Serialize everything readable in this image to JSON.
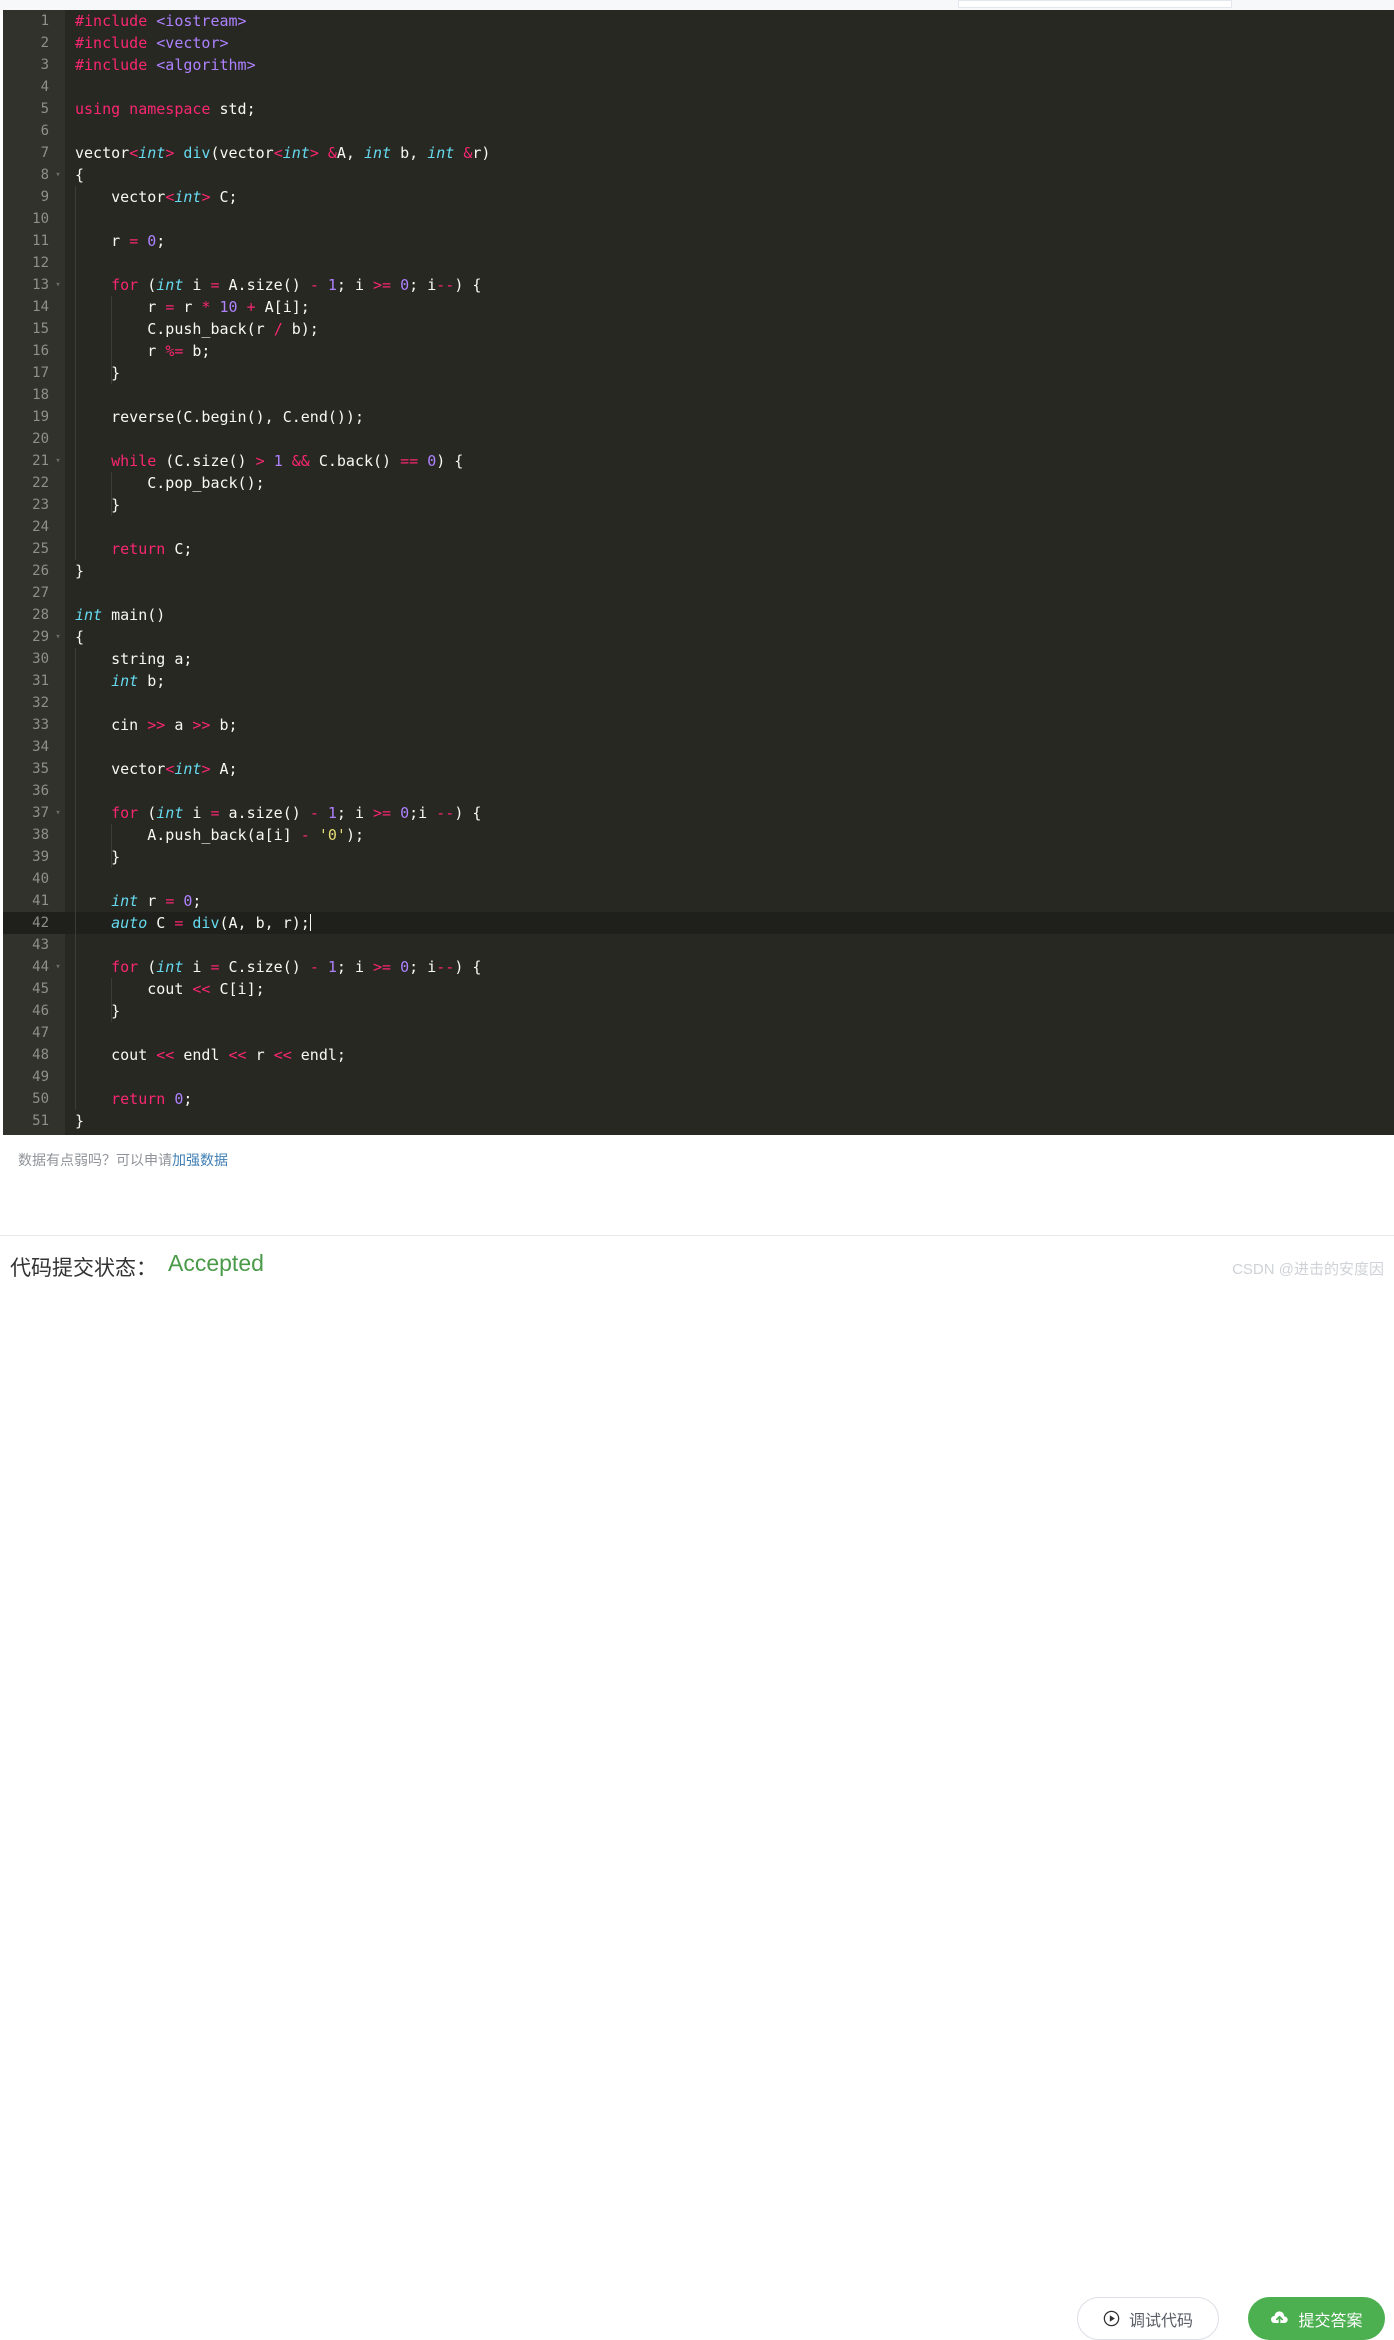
{
  "editor": {
    "language": "cpp",
    "current_line": 42,
    "theme_bg": "#272822",
    "gutter_bg": "#31322c",
    "current_line_bg": "#1f201b",
    "lines": [
      {
        "n": 1,
        "fold": false,
        "guides": 0,
        "tokens": [
          {
            "t": "#include ",
            "c": "inc"
          },
          {
            "t": "<iostream>",
            "c": "hdr"
          }
        ]
      },
      {
        "n": 2,
        "fold": false,
        "guides": 0,
        "tokens": [
          {
            "t": "#include ",
            "c": "inc"
          },
          {
            "t": "<vector>",
            "c": "hdr"
          }
        ]
      },
      {
        "n": 3,
        "fold": false,
        "guides": 0,
        "tokens": [
          {
            "t": "#include ",
            "c": "inc"
          },
          {
            "t": "<algorithm>",
            "c": "hdr"
          }
        ]
      },
      {
        "n": 4,
        "fold": false,
        "guides": 0,
        "tokens": []
      },
      {
        "n": 5,
        "fold": false,
        "guides": 0,
        "tokens": [
          {
            "t": "using namespace",
            "c": "k"
          },
          {
            "t": " std;",
            "c": "pl"
          }
        ]
      },
      {
        "n": 6,
        "fold": false,
        "guides": 0,
        "tokens": []
      },
      {
        "n": 7,
        "fold": false,
        "guides": 0,
        "tokens": [
          {
            "t": "vector",
            "c": "pl"
          },
          {
            "t": "<",
            "c": "k"
          },
          {
            "t": "int",
            "c": "ki"
          },
          {
            "t": ">",
            "c": "k"
          },
          {
            "t": " ",
            "c": "pl"
          },
          {
            "t": "div",
            "c": "fn"
          },
          {
            "t": "(vector",
            "c": "pl"
          },
          {
            "t": "<",
            "c": "k"
          },
          {
            "t": "int",
            "c": "ki"
          },
          {
            "t": ">",
            "c": "k"
          },
          {
            "t": " ",
            "c": "pl"
          },
          {
            "t": "&",
            "c": "k"
          },
          {
            "t": "A, ",
            "c": "pl"
          },
          {
            "t": "int",
            "c": "ki"
          },
          {
            "t": " b, ",
            "c": "pl"
          },
          {
            "t": "int",
            "c": "ki"
          },
          {
            "t": " ",
            "c": "pl"
          },
          {
            "t": "&",
            "c": "k"
          },
          {
            "t": "r)",
            "c": "pl"
          }
        ]
      },
      {
        "n": 8,
        "fold": true,
        "guides": 0,
        "tokens": [
          {
            "t": "{",
            "c": "pl"
          }
        ]
      },
      {
        "n": 9,
        "fold": false,
        "guides": 1,
        "tokens": [
          {
            "t": "    vector",
            "c": "pl"
          },
          {
            "t": "<",
            "c": "k"
          },
          {
            "t": "int",
            "c": "ki"
          },
          {
            "t": ">",
            "c": "k"
          },
          {
            "t": " C;",
            "c": "pl"
          }
        ]
      },
      {
        "n": 10,
        "fold": false,
        "guides": 1,
        "tokens": []
      },
      {
        "n": 11,
        "fold": false,
        "guides": 1,
        "tokens": [
          {
            "t": "    r ",
            "c": "pl"
          },
          {
            "t": "=",
            "c": "k"
          },
          {
            "t": " ",
            "c": "pl"
          },
          {
            "t": "0",
            "c": "num"
          },
          {
            "t": ";",
            "c": "pl"
          }
        ]
      },
      {
        "n": 12,
        "fold": false,
        "guides": 1,
        "tokens": []
      },
      {
        "n": 13,
        "fold": true,
        "guides": 1,
        "tokens": [
          {
            "t": "    ",
            "c": "pl"
          },
          {
            "t": "for",
            "c": "k"
          },
          {
            "t": " (",
            "c": "pl"
          },
          {
            "t": "int",
            "c": "ki"
          },
          {
            "t": " i ",
            "c": "pl"
          },
          {
            "t": "=",
            "c": "k"
          },
          {
            "t": " A.size() ",
            "c": "pl"
          },
          {
            "t": "-",
            "c": "k"
          },
          {
            "t": " ",
            "c": "pl"
          },
          {
            "t": "1",
            "c": "num"
          },
          {
            "t": "; i ",
            "c": "pl"
          },
          {
            "t": ">=",
            "c": "k"
          },
          {
            "t": " ",
            "c": "pl"
          },
          {
            "t": "0",
            "c": "num"
          },
          {
            "t": "; i",
            "c": "pl"
          },
          {
            "t": "--",
            "c": "k"
          },
          {
            "t": ") {",
            "c": "pl"
          }
        ]
      },
      {
        "n": 14,
        "fold": false,
        "guides": 2,
        "tokens": [
          {
            "t": "        r ",
            "c": "pl"
          },
          {
            "t": "=",
            "c": "k"
          },
          {
            "t": " r ",
            "c": "pl"
          },
          {
            "t": "*",
            "c": "k"
          },
          {
            "t": " ",
            "c": "pl"
          },
          {
            "t": "10",
            "c": "num"
          },
          {
            "t": " ",
            "c": "pl"
          },
          {
            "t": "+",
            "c": "k"
          },
          {
            "t": " A[i];",
            "c": "pl"
          }
        ]
      },
      {
        "n": 15,
        "fold": false,
        "guides": 2,
        "tokens": [
          {
            "t": "        C.push_back(r ",
            "c": "pl"
          },
          {
            "t": "/",
            "c": "k"
          },
          {
            "t": " b);",
            "c": "pl"
          }
        ]
      },
      {
        "n": 16,
        "fold": false,
        "guides": 2,
        "tokens": [
          {
            "t": "        r ",
            "c": "pl"
          },
          {
            "t": "%=",
            "c": "k"
          },
          {
            "t": " b;",
            "c": "pl"
          }
        ]
      },
      {
        "n": 17,
        "fold": false,
        "guides": 2,
        "tokens": [
          {
            "t": "    }",
            "c": "pl"
          }
        ]
      },
      {
        "n": 18,
        "fold": false,
        "guides": 1,
        "tokens": []
      },
      {
        "n": 19,
        "fold": false,
        "guides": 1,
        "tokens": [
          {
            "t": "    reverse(C.begin(), C.end());",
            "c": "pl"
          }
        ]
      },
      {
        "n": 20,
        "fold": false,
        "guides": 1,
        "tokens": []
      },
      {
        "n": 21,
        "fold": true,
        "guides": 1,
        "tokens": [
          {
            "t": "    ",
            "c": "pl"
          },
          {
            "t": "while",
            "c": "k"
          },
          {
            "t": " (C.size() ",
            "c": "pl"
          },
          {
            "t": ">",
            "c": "k"
          },
          {
            "t": " ",
            "c": "pl"
          },
          {
            "t": "1",
            "c": "num"
          },
          {
            "t": " ",
            "c": "pl"
          },
          {
            "t": "&&",
            "c": "k"
          },
          {
            "t": " C.back() ",
            "c": "pl"
          },
          {
            "t": "==",
            "c": "k"
          },
          {
            "t": " ",
            "c": "pl"
          },
          {
            "t": "0",
            "c": "num"
          },
          {
            "t": ") {",
            "c": "pl"
          }
        ]
      },
      {
        "n": 22,
        "fold": false,
        "guides": 2,
        "tokens": [
          {
            "t": "        C.pop_back();",
            "c": "pl"
          }
        ]
      },
      {
        "n": 23,
        "fold": false,
        "guides": 2,
        "tokens": [
          {
            "t": "    }",
            "c": "pl"
          }
        ]
      },
      {
        "n": 24,
        "fold": false,
        "guides": 1,
        "tokens": []
      },
      {
        "n": 25,
        "fold": false,
        "guides": 1,
        "tokens": [
          {
            "t": "    ",
            "c": "pl"
          },
          {
            "t": "return",
            "c": "k"
          },
          {
            "t": " C;",
            "c": "pl"
          }
        ]
      },
      {
        "n": 26,
        "fold": false,
        "guides": 0,
        "tokens": [
          {
            "t": "}",
            "c": "pl"
          }
        ]
      },
      {
        "n": 27,
        "fold": false,
        "guides": 0,
        "tokens": []
      },
      {
        "n": 28,
        "fold": false,
        "guides": 0,
        "tokens": [
          {
            "t": "int",
            "c": "ki"
          },
          {
            "t": " main()",
            "c": "pl"
          }
        ]
      },
      {
        "n": 29,
        "fold": true,
        "guides": 0,
        "tokens": [
          {
            "t": "{",
            "c": "pl"
          }
        ]
      },
      {
        "n": 30,
        "fold": false,
        "guides": 1,
        "tokens": [
          {
            "t": "    string a;",
            "c": "pl"
          }
        ]
      },
      {
        "n": 31,
        "fold": false,
        "guides": 1,
        "tokens": [
          {
            "t": "    ",
            "c": "pl"
          },
          {
            "t": "int",
            "c": "ki"
          },
          {
            "t": " b;",
            "c": "pl"
          }
        ]
      },
      {
        "n": 32,
        "fold": false,
        "guides": 1,
        "tokens": []
      },
      {
        "n": 33,
        "fold": false,
        "guides": 1,
        "tokens": [
          {
            "t": "    cin ",
            "c": "pl"
          },
          {
            "t": ">>",
            "c": "k"
          },
          {
            "t": " a ",
            "c": "pl"
          },
          {
            "t": ">>",
            "c": "k"
          },
          {
            "t": " b;",
            "c": "pl"
          }
        ]
      },
      {
        "n": 34,
        "fold": false,
        "guides": 1,
        "tokens": []
      },
      {
        "n": 35,
        "fold": false,
        "guides": 1,
        "tokens": [
          {
            "t": "    vector",
            "c": "pl"
          },
          {
            "t": "<",
            "c": "k"
          },
          {
            "t": "int",
            "c": "ki"
          },
          {
            "t": ">",
            "c": "k"
          },
          {
            "t": " A;",
            "c": "pl"
          }
        ]
      },
      {
        "n": 36,
        "fold": false,
        "guides": 1,
        "tokens": []
      },
      {
        "n": 37,
        "fold": true,
        "guides": 1,
        "tokens": [
          {
            "t": "    ",
            "c": "pl"
          },
          {
            "t": "for",
            "c": "k"
          },
          {
            "t": " (",
            "c": "pl"
          },
          {
            "t": "int",
            "c": "ki"
          },
          {
            "t": " i ",
            "c": "pl"
          },
          {
            "t": "=",
            "c": "k"
          },
          {
            "t": " a.size() ",
            "c": "pl"
          },
          {
            "t": "-",
            "c": "k"
          },
          {
            "t": " ",
            "c": "pl"
          },
          {
            "t": "1",
            "c": "num"
          },
          {
            "t": "; i ",
            "c": "pl"
          },
          {
            "t": ">=",
            "c": "k"
          },
          {
            "t": " ",
            "c": "pl"
          },
          {
            "t": "0",
            "c": "num"
          },
          {
            "t": ";i ",
            "c": "pl"
          },
          {
            "t": "--",
            "c": "k"
          },
          {
            "t": ") {",
            "c": "pl"
          }
        ]
      },
      {
        "n": 38,
        "fold": false,
        "guides": 2,
        "tokens": [
          {
            "t": "        A.push_back(a[i] ",
            "c": "pl"
          },
          {
            "t": "-",
            "c": "k"
          },
          {
            "t": " ",
            "c": "pl"
          },
          {
            "t": "'0'",
            "c": "str"
          },
          {
            "t": ");",
            "c": "pl"
          }
        ]
      },
      {
        "n": 39,
        "fold": false,
        "guides": 2,
        "tokens": [
          {
            "t": "    }",
            "c": "pl"
          }
        ]
      },
      {
        "n": 40,
        "fold": false,
        "guides": 1,
        "tokens": []
      },
      {
        "n": 41,
        "fold": false,
        "guides": 1,
        "tokens": [
          {
            "t": "    ",
            "c": "pl"
          },
          {
            "t": "int",
            "c": "ki"
          },
          {
            "t": " r ",
            "c": "pl"
          },
          {
            "t": "=",
            "c": "k"
          },
          {
            "t": " ",
            "c": "pl"
          },
          {
            "t": "0",
            "c": "num"
          },
          {
            "t": ";",
            "c": "pl"
          }
        ]
      },
      {
        "n": 42,
        "fold": false,
        "guides": 1,
        "caret": true,
        "tokens": [
          {
            "t": "    ",
            "c": "pl"
          },
          {
            "t": "auto",
            "c": "ki"
          },
          {
            "t": " C ",
            "c": "pl"
          },
          {
            "t": "=",
            "c": "k"
          },
          {
            "t": " ",
            "c": "pl"
          },
          {
            "t": "div",
            "c": "fn"
          },
          {
            "t": "(A, b, r);",
            "c": "pl"
          }
        ]
      },
      {
        "n": 43,
        "fold": false,
        "guides": 1,
        "tokens": []
      },
      {
        "n": 44,
        "fold": true,
        "guides": 1,
        "tokens": [
          {
            "t": "    ",
            "c": "pl"
          },
          {
            "t": "for",
            "c": "k"
          },
          {
            "t": " (",
            "c": "pl"
          },
          {
            "t": "int",
            "c": "ki"
          },
          {
            "t": " i ",
            "c": "pl"
          },
          {
            "t": "=",
            "c": "k"
          },
          {
            "t": " C.size() ",
            "c": "pl"
          },
          {
            "t": "-",
            "c": "k"
          },
          {
            "t": " ",
            "c": "pl"
          },
          {
            "t": "1",
            "c": "num"
          },
          {
            "t": "; i ",
            "c": "pl"
          },
          {
            "t": ">=",
            "c": "k"
          },
          {
            "t": " ",
            "c": "pl"
          },
          {
            "t": "0",
            "c": "num"
          },
          {
            "t": "; i",
            "c": "pl"
          },
          {
            "t": "--",
            "c": "k"
          },
          {
            "t": ") {",
            "c": "pl"
          }
        ]
      },
      {
        "n": 45,
        "fold": false,
        "guides": 2,
        "tokens": [
          {
            "t": "        cout ",
            "c": "pl"
          },
          {
            "t": "<<",
            "c": "k"
          },
          {
            "t": " C[i];",
            "c": "pl"
          }
        ]
      },
      {
        "n": 46,
        "fold": false,
        "guides": 2,
        "tokens": [
          {
            "t": "    }",
            "c": "pl"
          }
        ]
      },
      {
        "n": 47,
        "fold": false,
        "guides": 1,
        "tokens": []
      },
      {
        "n": 48,
        "fold": false,
        "guides": 1,
        "tokens": [
          {
            "t": "    cout ",
            "c": "pl"
          },
          {
            "t": "<<",
            "c": "k"
          },
          {
            "t": " endl ",
            "c": "pl"
          },
          {
            "t": "<<",
            "c": "k"
          },
          {
            "t": " r ",
            "c": "pl"
          },
          {
            "t": "<<",
            "c": "k"
          },
          {
            "t": " endl;",
            "c": "pl"
          }
        ]
      },
      {
        "n": 49,
        "fold": false,
        "guides": 1,
        "tokens": []
      },
      {
        "n": 50,
        "fold": false,
        "guides": 1,
        "tokens": [
          {
            "t": "    ",
            "c": "pl"
          },
          {
            "t": "return",
            "c": "k"
          },
          {
            "t": " ",
            "c": "pl"
          },
          {
            "t": "0",
            "c": "num"
          },
          {
            "t": ";",
            "c": "pl"
          }
        ]
      },
      {
        "n": 51,
        "fold": false,
        "guides": 0,
        "tokens": [
          {
            "t": "}",
            "c": "pl"
          }
        ]
      }
    ]
  },
  "action_bar": {
    "weak_data_text": "数据有点弱吗？可以申请",
    "weak_data_link": "加强数据",
    "debug_button_label": "调试代码",
    "debug_button_icon": "play-circle-icon",
    "submit_button_label": "提交答案",
    "submit_button_icon": "upload-cloud-icon",
    "submit_button_color": "#4caf50"
  },
  "status": {
    "label": "代码提交状态：",
    "value": "Accepted",
    "value_color": "#4a9a4a"
  },
  "watermark": {
    "text": "CSDN @进击的安度因"
  }
}
